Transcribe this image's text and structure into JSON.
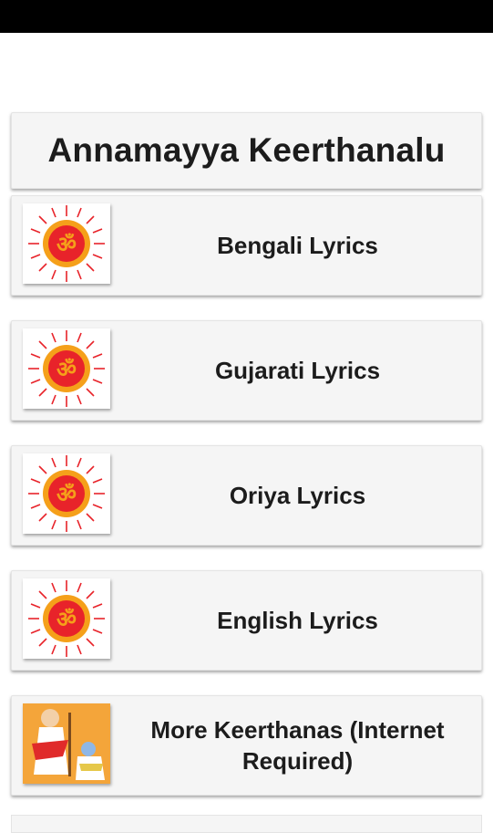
{
  "app": {
    "title": "Annamayya Keerthanalu"
  },
  "menu": {
    "items": [
      {
        "label": "Bengali Lyrics",
        "icon": "om-sun-icon"
      },
      {
        "label": "Gujarati Lyrics",
        "icon": "om-sun-icon"
      },
      {
        "label": "Oriya Lyrics",
        "icon": "om-sun-icon"
      },
      {
        "label": "English Lyrics",
        "icon": "om-sun-icon"
      },
      {
        "label": "More Keerthanas (Internet Required)",
        "icon": "saint-illustration-icon"
      }
    ]
  },
  "colors": {
    "accent_red": "#e8232a",
    "accent_orange": "#f5a01a",
    "card_bg": "#f5f5f5",
    "status_bar": "#000000"
  }
}
